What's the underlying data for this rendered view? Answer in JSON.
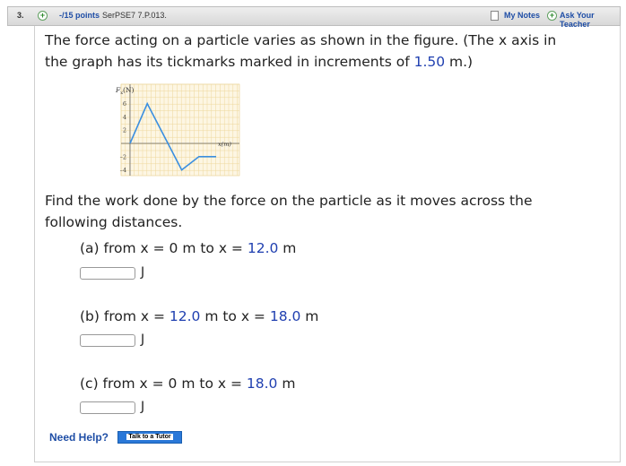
{
  "header": {
    "question_number": "3.",
    "plus_symbol": "+",
    "points": "-/15 points",
    "source": "SerPSE7 7.P.013.",
    "my_notes_label": "My Notes",
    "ask_teacher_label": "Ask Your Teacher"
  },
  "problem": {
    "line1": "The force acting on a particle varies as shown in the figure. (The x axis in",
    "line2_before": "the graph has its tickmarks marked in increments of ",
    "tick_increment": "1.50",
    "line2_after": " m.)"
  },
  "figure": {
    "y_axis_label": "F",
    "y_axis_subscript": "x",
    "y_axis_unit": "(N)",
    "x_axis_label": "x(m)",
    "y_ticks": [
      "6",
      "4",
      "2",
      "–2",
      "–4"
    ],
    "polyline_color": "#3b8fe0",
    "chart_data": {
      "type": "line",
      "x_units": "tick marks (increments of 1.50 m)",
      "x": [
        0,
        2,
        6,
        8,
        10
      ],
      "y": [
        0,
        6,
        -4,
        -2,
        -2
      ],
      "ylim": [
        -4,
        6
      ],
      "grid": true
    }
  },
  "prompt": {
    "line1": "Find the work done by the force on the particle as it moves across the",
    "line2": "following distances."
  },
  "parts": [
    {
      "label_start": "(a) from x = 0 m to x = ",
      "value": "12.0",
      "label_end": " m",
      "unit": "J",
      "answer": ""
    },
    {
      "label_start": "(b) from x = ",
      "value_start": "12.0",
      "label_mid": " m to x = ",
      "value": "18.0",
      "label_end": " m",
      "unit": "J",
      "answer": ""
    },
    {
      "label_start": "(c) from x = 0 m to x = ",
      "value": "18.0",
      "label_end": " m",
      "unit": "J",
      "answer": ""
    }
  ],
  "help": {
    "need_help": "Need Help?",
    "talk_to_tutor": "Talk to a Tutor"
  }
}
